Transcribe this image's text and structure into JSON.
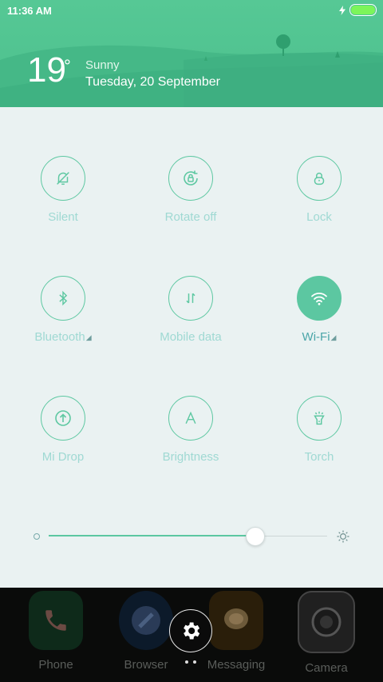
{
  "status": {
    "time": "11:36 AM"
  },
  "weather": {
    "temperature": "19",
    "degree": "°",
    "condition": "Sunny",
    "date": "Tuesday, 20 September"
  },
  "toggles": [
    {
      "label": "Silent",
      "icon": "silent-bell-icon",
      "active": false
    },
    {
      "label": "Rotate off",
      "icon": "rotate-lock-icon",
      "active": false
    },
    {
      "label": "Lock",
      "icon": "lock-icon",
      "active": false
    },
    {
      "label": "Bluetooth",
      "icon": "bluetooth-icon",
      "active": false,
      "expandable": true
    },
    {
      "label": "Mobile data",
      "icon": "mobile-data-icon",
      "active": false
    },
    {
      "label": "Wi-Fi",
      "icon": "wifi-icon",
      "active": true,
      "expandable": true
    },
    {
      "label": "Mi Drop",
      "icon": "mi-drop-icon",
      "active": false
    },
    {
      "label": "Brightness",
      "icon": "brightness-auto-icon",
      "active": false
    },
    {
      "label": "Torch",
      "icon": "torch-icon",
      "active": false
    }
  ],
  "brightness": {
    "level": 0.74
  },
  "dock": {
    "apps": [
      {
        "label": "Phone",
        "icon": "phone-icon"
      },
      {
        "label": "Browser",
        "icon": "browser-icon"
      },
      {
        "label": "Messaging",
        "icon": "messaging-icon"
      },
      {
        "label": "Camera",
        "icon": "camera-icon"
      }
    ]
  },
  "colors": {
    "accent": "#5cc7a1",
    "header": "#4fc38f",
    "panel": "#eaf2f2"
  }
}
